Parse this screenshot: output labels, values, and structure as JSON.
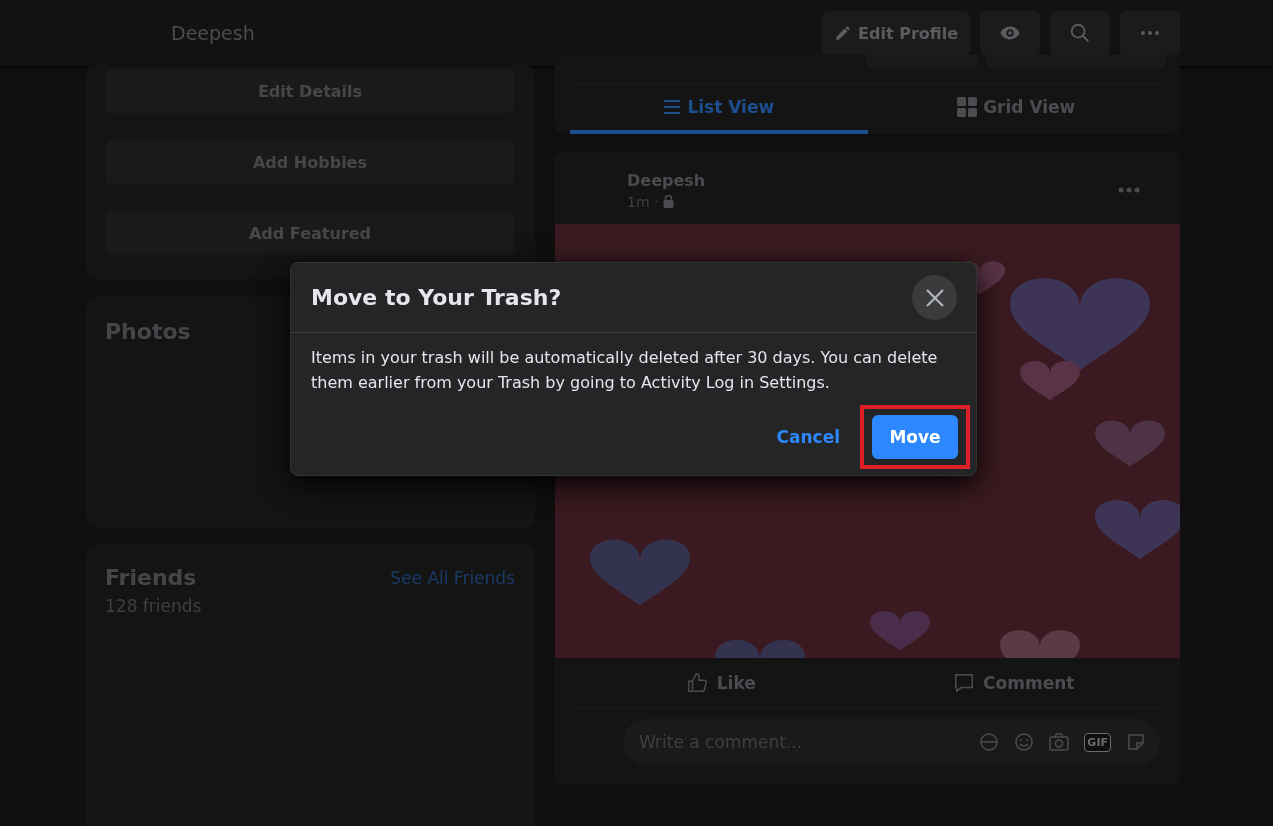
{
  "header": {
    "name": "Deepesh",
    "buttons": [
      {
        "kind": "edit",
        "label": "Edit Profile"
      },
      {
        "kind": "view"
      },
      {
        "kind": "search"
      },
      {
        "kind": "more"
      }
    ]
  },
  "intro": {
    "buttons": [
      "Edit Details",
      "Add Hobbies",
      "Add Featured"
    ]
  },
  "photos": {
    "title": "Photos"
  },
  "friends": {
    "title": "Friends",
    "link": "See All Friends",
    "count": "128 friends"
  },
  "view_tabs": [
    {
      "kind": "list",
      "label": "List View",
      "selected": true
    },
    {
      "kind": "grid",
      "label": "Grid View",
      "selected": false
    }
  ],
  "post": {
    "author": "Deepesh",
    "time": "1m ·",
    "actions": [
      {
        "kind": "like",
        "label": "Like"
      },
      {
        "kind": "comment",
        "label": "Comment"
      }
    ],
    "comment_placeholder": "Write a comment...",
    "gif_label": "GIF"
  },
  "dialog": {
    "title": "Move to Your Trash?",
    "message": "Items in your trash will be automatically deleted after 30 days. You can delete them earlier from your Trash by going to Activity Log in Settings.",
    "cancel": "Cancel",
    "confirm": "Move",
    "confirm_highlighted": true
  }
}
